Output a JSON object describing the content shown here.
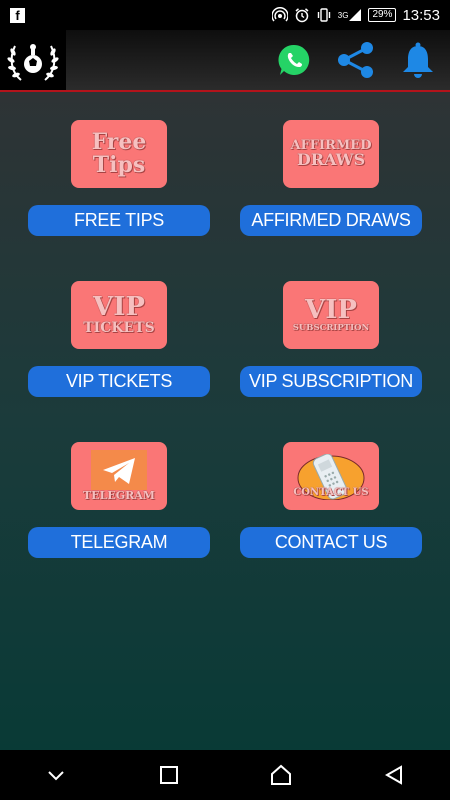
{
  "statusbar": {
    "facebook_glyph": "f",
    "network_label": "3G",
    "battery": "29%",
    "time": "13:53",
    "icons": [
      "hotspot-icon",
      "alarm-icon",
      "vibrate-icon",
      "signal-icon",
      "battery-icon"
    ]
  },
  "appbar": {
    "logo": "laurel-wreath-football-icon",
    "actions": [
      "whatsapp-icon",
      "share-icon",
      "bell-icon"
    ],
    "accent_color": "#b3131b"
  },
  "tiles": [
    {
      "image_line1": "Free",
      "image_line2": "Tips",
      "label": "FREE TIPS"
    },
    {
      "image_line1": "AFFIRMED",
      "image_line2": "DRAWS",
      "label": "AFFIRMED DRAWS"
    },
    {
      "image_line1": "VIP",
      "image_line2": "TICKETS",
      "label": "VIP TICKETS"
    },
    {
      "image_line1": "VIP",
      "image_line2": "SUBSCRIPTION",
      "label": "VIP SUBSCRIPTION"
    },
    {
      "image_line1": "",
      "image_line2": "TELEGRAM",
      "label": "TELEGRAM"
    },
    {
      "image_line1": "",
      "image_line2": "CONTACT US",
      "label": "CONTACT US"
    }
  ],
  "colors": {
    "tile_bg": "#fa7676",
    "button_bg": "#1f6fdb",
    "whatsapp": "#25d366",
    "share": "#1e88e5",
    "bell": "#1e88e5"
  },
  "navbar": [
    "back-chevron-icon",
    "recents-icon",
    "home-icon",
    "back-icon"
  ]
}
